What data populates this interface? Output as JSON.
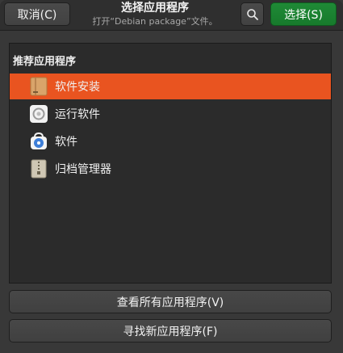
{
  "header": {
    "cancel_label": "取消(C)",
    "title": "选择应用程序",
    "subtitle": "打开“Debian package”文件。",
    "search_icon": "search-icon",
    "select_label": "选择(S)",
    "accent_color": "#1f8a36"
  },
  "list": {
    "section_title": "推荐应用程序",
    "selection_color": "#e95420",
    "items": [
      {
        "label": "软件安装",
        "icon": "package-installer-icon",
        "selected": true
      },
      {
        "label": "运行软件",
        "icon": "run-software-icon",
        "selected": false
      },
      {
        "label": "软件",
        "icon": "software-store-icon",
        "selected": false
      },
      {
        "label": "归档管理器",
        "icon": "archive-manager-icon",
        "selected": false
      }
    ]
  },
  "footer": {
    "view_all_label": "查看所有应用程序(V)",
    "find_new_label": "寻找新应用程序(F)"
  }
}
